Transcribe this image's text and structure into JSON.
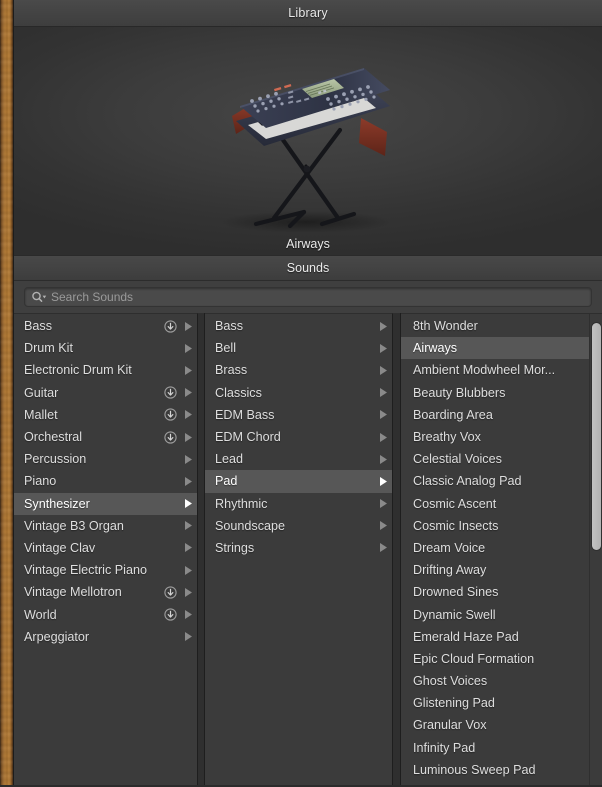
{
  "window": {
    "title": "Library"
  },
  "preview": {
    "instrument_name": "Airways",
    "image_alt": "synthesizer-on-x-stand"
  },
  "sounds_panel": {
    "header": "Sounds",
    "search": {
      "placeholder": "Search Sounds",
      "value": "",
      "icon": "search-icon",
      "menu_icon": "chevron-down-icon"
    }
  },
  "colors": {
    "panel_bg": "#3b3b3b",
    "header_bg": "#434343",
    "selected_row": "#575757",
    "text": "#dedede",
    "text_selected": "#ffffff",
    "wood_edge": "#a5702f",
    "scrollbar_thumb": "#bdbdbd"
  },
  "columns": [
    {
      "name": "categories",
      "items": [
        {
          "label": "Bass",
          "has_download": true,
          "has_arrow": true,
          "selected": false
        },
        {
          "label": "Drum Kit",
          "has_download": false,
          "has_arrow": true,
          "selected": false
        },
        {
          "label": "Electronic Drum Kit",
          "has_download": false,
          "has_arrow": true,
          "selected": false
        },
        {
          "label": "Guitar",
          "has_download": true,
          "has_arrow": true,
          "selected": false
        },
        {
          "label": "Mallet",
          "has_download": true,
          "has_arrow": true,
          "selected": false
        },
        {
          "label": "Orchestral",
          "has_download": true,
          "has_arrow": true,
          "selected": false
        },
        {
          "label": "Percussion",
          "has_download": false,
          "has_arrow": true,
          "selected": false
        },
        {
          "label": "Piano",
          "has_download": false,
          "has_arrow": true,
          "selected": false
        },
        {
          "label": "Synthesizer",
          "has_download": false,
          "has_arrow": true,
          "selected": true
        },
        {
          "label": "Vintage B3 Organ",
          "has_download": false,
          "has_arrow": true,
          "selected": false
        },
        {
          "label": "Vintage Clav",
          "has_download": false,
          "has_arrow": true,
          "selected": false
        },
        {
          "label": "Vintage Electric Piano",
          "has_download": false,
          "has_arrow": true,
          "selected": false
        },
        {
          "label": "Vintage Mellotron",
          "has_download": true,
          "has_arrow": true,
          "selected": false
        },
        {
          "label": "World",
          "has_download": true,
          "has_arrow": true,
          "selected": false
        },
        {
          "label": "Arpeggiator",
          "has_download": false,
          "has_arrow": true,
          "selected": false
        }
      ]
    },
    {
      "name": "subcategories",
      "items": [
        {
          "label": "Bass",
          "has_download": false,
          "has_arrow": true,
          "selected": false
        },
        {
          "label": "Bell",
          "has_download": false,
          "has_arrow": true,
          "selected": false
        },
        {
          "label": "Brass",
          "has_download": false,
          "has_arrow": true,
          "selected": false
        },
        {
          "label": "Classics",
          "has_download": false,
          "has_arrow": true,
          "selected": false
        },
        {
          "label": "EDM Bass",
          "has_download": false,
          "has_arrow": true,
          "selected": false
        },
        {
          "label": "EDM Chord",
          "has_download": false,
          "has_arrow": true,
          "selected": false
        },
        {
          "label": "Lead",
          "has_download": false,
          "has_arrow": true,
          "selected": false
        },
        {
          "label": "Pad",
          "has_download": false,
          "has_arrow": true,
          "selected": true
        },
        {
          "label": "Rhythmic",
          "has_download": false,
          "has_arrow": true,
          "selected": false
        },
        {
          "label": "Soundscape",
          "has_download": false,
          "has_arrow": true,
          "selected": false
        },
        {
          "label": "Strings",
          "has_download": false,
          "has_arrow": true,
          "selected": false
        }
      ]
    },
    {
      "name": "patches",
      "scrollbar": {
        "visible": true,
        "thumb_top_pct": 2,
        "thumb_height_pct": 48
      },
      "items": [
        {
          "label": "8th Wonder",
          "has_download": false,
          "has_arrow": false,
          "selected": false
        },
        {
          "label": "Airways",
          "has_download": false,
          "has_arrow": false,
          "selected": true
        },
        {
          "label": "Ambient Modwheel Mor...",
          "has_download": false,
          "has_arrow": false,
          "selected": false
        },
        {
          "label": "Beauty Blubbers",
          "has_download": false,
          "has_arrow": false,
          "selected": false
        },
        {
          "label": "Boarding Area",
          "has_download": false,
          "has_arrow": false,
          "selected": false
        },
        {
          "label": "Breathy Vox",
          "has_download": false,
          "has_arrow": false,
          "selected": false
        },
        {
          "label": "Celestial Voices",
          "has_download": false,
          "has_arrow": false,
          "selected": false
        },
        {
          "label": "Classic Analog Pad",
          "has_download": false,
          "has_arrow": false,
          "selected": false
        },
        {
          "label": "Cosmic Ascent",
          "has_download": false,
          "has_arrow": false,
          "selected": false
        },
        {
          "label": "Cosmic Insects",
          "has_download": false,
          "has_arrow": false,
          "selected": false
        },
        {
          "label": "Dream Voice",
          "has_download": false,
          "has_arrow": false,
          "selected": false
        },
        {
          "label": "Drifting Away",
          "has_download": false,
          "has_arrow": false,
          "selected": false
        },
        {
          "label": "Drowned Sines",
          "has_download": false,
          "has_arrow": false,
          "selected": false
        },
        {
          "label": "Dynamic Swell",
          "has_download": false,
          "has_arrow": false,
          "selected": false
        },
        {
          "label": "Emerald Haze Pad",
          "has_download": false,
          "has_arrow": false,
          "selected": false
        },
        {
          "label": "Epic Cloud Formation",
          "has_download": false,
          "has_arrow": false,
          "selected": false
        },
        {
          "label": "Ghost Voices",
          "has_download": false,
          "has_arrow": false,
          "selected": false
        },
        {
          "label": "Glistening Pad",
          "has_download": false,
          "has_arrow": false,
          "selected": false
        },
        {
          "label": "Granular Vox",
          "has_download": false,
          "has_arrow": false,
          "selected": false
        },
        {
          "label": "Infinity Pad",
          "has_download": false,
          "has_arrow": false,
          "selected": false
        },
        {
          "label": "Luminous Sweep Pad",
          "has_download": false,
          "has_arrow": false,
          "selected": false
        }
      ]
    }
  ]
}
